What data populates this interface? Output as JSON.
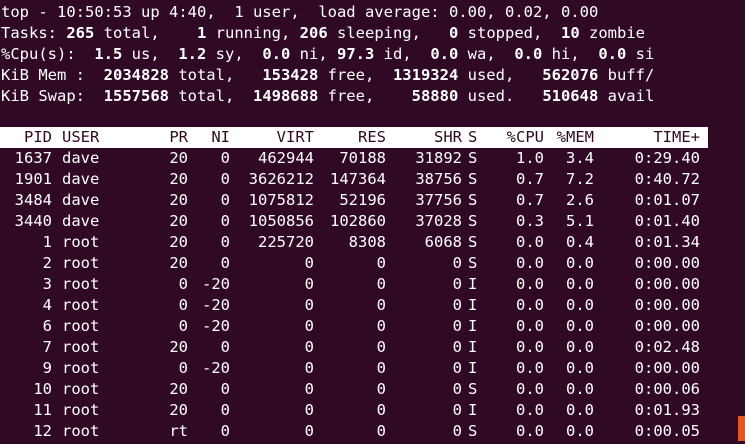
{
  "summary": {
    "line1": {
      "prefix": "top - ",
      "time": "10:50:53",
      "up_label": " up ",
      "uptime": "4:40",
      "sep1": ",  ",
      "users": "1 user",
      "sep2": ",  ",
      "load_label": "load average: ",
      "load": "0.00, 0.02, 0.00"
    },
    "tasks": {
      "label": "Tasks: ",
      "total": "265",
      "total_label": " total,    ",
      "running": "1",
      "running_label": " running, ",
      "sleeping": "206",
      "sleeping_label": " sleeping,   ",
      "stopped": "0",
      "stopped_label": " stopped,  ",
      "zombie": "10",
      "zombie_label": " zombie"
    },
    "cpu": {
      "label": "%Cpu(s):  ",
      "us": "1.5",
      "us_label": " us,  ",
      "sy": "1.2",
      "sy_label": " sy,  ",
      "ni": "0.0",
      "ni_label": " ni, ",
      "id": "97.3",
      "id_label": " id,  ",
      "wa": "0.0",
      "wa_label": " wa,  ",
      "hi": "0.0",
      "hi_label": " hi,  ",
      "si": "0.0",
      "si_label": " si"
    },
    "mem": {
      "label": "KiB Mem :  ",
      "total": "2034828",
      "total_label": " total,   ",
      "free": "153428",
      "free_label": " free,  ",
      "used": "1319324",
      "used_label": " used,   ",
      "buff": "562076",
      "buff_label": " buff/"
    },
    "swap": {
      "label": "KiB Swap:  ",
      "total": "1557568",
      "total_label": " total,  ",
      "free": "1498688",
      "free_label": " free,    ",
      "used": "58880",
      "used_label": " used.   ",
      "avail": "510648",
      "avail_label": " avail"
    }
  },
  "columns": [
    "PID",
    "USER",
    "PR",
    "NI",
    "VIRT",
    "RES",
    "SHR",
    "S",
    "%CPU",
    "%MEM",
    "TIME+"
  ],
  "processes": [
    {
      "pid": "1637",
      "user": "dave",
      "pr": "20",
      "ni": "0",
      "virt": "462944",
      "res": "70188",
      "shr": "31892",
      "s": "S",
      "cpu": "1.0",
      "mem": "3.4",
      "time": "0:29.40"
    },
    {
      "pid": "1901",
      "user": "dave",
      "pr": "20",
      "ni": "0",
      "virt": "3626212",
      "res": "147364",
      "shr": "38756",
      "s": "S",
      "cpu": "0.7",
      "mem": "7.2",
      "time": "0:40.72"
    },
    {
      "pid": "3484",
      "user": "dave",
      "pr": "20",
      "ni": "0",
      "virt": "1075812",
      "res": "52196",
      "shr": "37756",
      "s": "S",
      "cpu": "0.7",
      "mem": "2.6",
      "time": "0:01.07"
    },
    {
      "pid": "3440",
      "user": "dave",
      "pr": "20",
      "ni": "0",
      "virt": "1050856",
      "res": "102860",
      "shr": "37028",
      "s": "S",
      "cpu": "0.3",
      "mem": "5.1",
      "time": "0:01.40"
    },
    {
      "pid": "1",
      "user": "root",
      "pr": "20",
      "ni": "0",
      "virt": "225720",
      "res": "8308",
      "shr": "6068",
      "s": "S",
      "cpu": "0.0",
      "mem": "0.4",
      "time": "0:01.34"
    },
    {
      "pid": "2",
      "user": "root",
      "pr": "20",
      "ni": "0",
      "virt": "0",
      "res": "0",
      "shr": "0",
      "s": "S",
      "cpu": "0.0",
      "mem": "0.0",
      "time": "0:00.00"
    },
    {
      "pid": "3",
      "user": "root",
      "pr": "0",
      "ni": "-20",
      "virt": "0",
      "res": "0",
      "shr": "0",
      "s": "I",
      "cpu": "0.0",
      "mem": "0.0",
      "time": "0:00.00"
    },
    {
      "pid": "4",
      "user": "root",
      "pr": "0",
      "ni": "-20",
      "virt": "0",
      "res": "0",
      "shr": "0",
      "s": "I",
      "cpu": "0.0",
      "mem": "0.0",
      "time": "0:00.00"
    },
    {
      "pid": "6",
      "user": "root",
      "pr": "0",
      "ni": "-20",
      "virt": "0",
      "res": "0",
      "shr": "0",
      "s": "I",
      "cpu": "0.0",
      "mem": "0.0",
      "time": "0:00.00"
    },
    {
      "pid": "7",
      "user": "root",
      "pr": "20",
      "ni": "0",
      "virt": "0",
      "res": "0",
      "shr": "0",
      "s": "I",
      "cpu": "0.0",
      "mem": "0.0",
      "time": "0:02.48"
    },
    {
      "pid": "9",
      "user": "root",
      "pr": "0",
      "ni": "-20",
      "virt": "0",
      "res": "0",
      "shr": "0",
      "s": "I",
      "cpu": "0.0",
      "mem": "0.0",
      "time": "0:00.00"
    },
    {
      "pid": "10",
      "user": "root",
      "pr": "20",
      "ni": "0",
      "virt": "0",
      "res": "0",
      "shr": "0",
      "s": "S",
      "cpu": "0.0",
      "mem": "0.0",
      "time": "0:00.06"
    },
    {
      "pid": "11",
      "user": "root",
      "pr": "20",
      "ni": "0",
      "virt": "0",
      "res": "0",
      "shr": "0",
      "s": "I",
      "cpu": "0.0",
      "mem": "0.0",
      "time": "0:01.93"
    },
    {
      "pid": "12",
      "user": "root",
      "pr": "rt",
      "ni": "0",
      "virt": "0",
      "res": "0",
      "shr": "0",
      "s": "S",
      "cpu": "0.0",
      "mem": "0.0",
      "time": "0:00.05"
    }
  ]
}
